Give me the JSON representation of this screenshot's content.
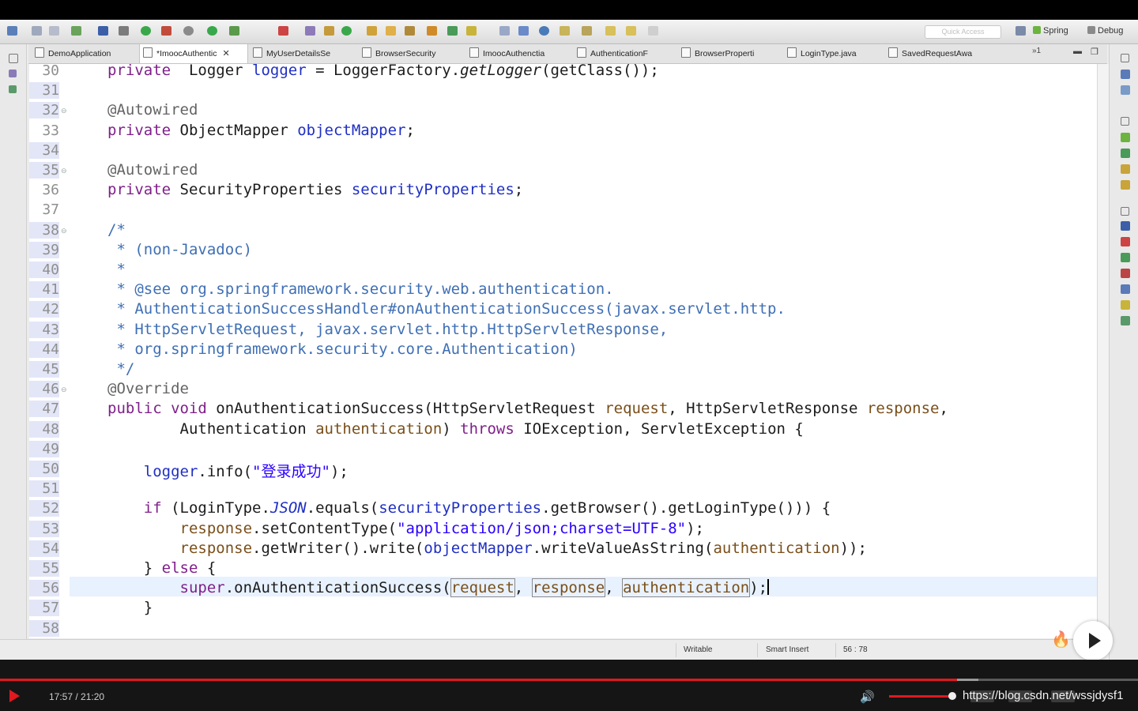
{
  "toolbar": {
    "quick_access_placeholder": "Quick Access",
    "perspectives": [
      {
        "label": "Spring",
        "icon": "spring-leaf-icon",
        "color": "#6db33f"
      },
      {
        "label": "Debug",
        "icon": "debug-bug-icon",
        "color": "#6a6a6a"
      }
    ]
  },
  "tabs": [
    {
      "label": "DemoApplication",
      "active": false,
      "dirty": false
    },
    {
      "label": "*ImoocAuthentic",
      "active": true,
      "dirty": true,
      "close_glyph": "✕"
    },
    {
      "label": "MyUserDetailsSe",
      "active": false
    },
    {
      "label": "BrowserSecurity",
      "active": false
    },
    {
      "label": "ImoocAuthenctia",
      "active": false
    },
    {
      "label": "AuthenticationF",
      "active": false
    },
    {
      "label": "BrowserProperti",
      "active": false
    },
    {
      "label": "LoginType.java",
      "active": false
    },
    {
      "label": "SavedRequestAwa",
      "active": false
    }
  ],
  "tabs_overflow": "»1",
  "editor": {
    "current_line": 56,
    "line_numbers": [
      "30",
      "31",
      "32",
      "33",
      "34",
      "35",
      "36",
      "37",
      "38",
      "39",
      "40",
      "41",
      "42",
      "43",
      "44",
      "45",
      "46",
      "47",
      "48",
      "49",
      "50",
      "51",
      "52",
      "53",
      "54",
      "55",
      "56",
      "57",
      "58"
    ],
    "lines": [
      {
        "no": 30,
        "seg": [
          [
            "kw",
            "private"
          ],
          [
            "",
            "  Logger "
          ],
          [
            "fld",
            "logger"
          ],
          [
            "",
            " = LoggerFactory."
          ],
          [
            "it",
            "getLogger"
          ],
          [
            "",
            "(getClass());"
          ]
        ]
      },
      {
        "no": 31,
        "seg": []
      },
      {
        "no": 32,
        "seg": [
          [
            "ann",
            "@Autowired"
          ]
        ]
      },
      {
        "no": 33,
        "seg": [
          [
            "kw",
            "private"
          ],
          [
            "",
            " ObjectMapper "
          ],
          [
            "fld",
            "objectMapper"
          ],
          [
            "",
            ";"
          ]
        ]
      },
      {
        "no": 34,
        "seg": []
      },
      {
        "no": 35,
        "seg": [
          [
            "ann",
            "@Autowired"
          ]
        ]
      },
      {
        "no": 36,
        "seg": [
          [
            "kw",
            "private"
          ],
          [
            "",
            " SecurityProperties "
          ],
          [
            "fld",
            "securityProperties"
          ],
          [
            "",
            ";"
          ]
        ]
      },
      {
        "no": 37,
        "seg": []
      },
      {
        "no": 38,
        "seg": [
          [
            "cmt",
            "/*"
          ]
        ]
      },
      {
        "no": 39,
        "seg": [
          [
            "cmt",
            " * (non-Javadoc)"
          ]
        ]
      },
      {
        "no": 40,
        "seg": [
          [
            "cmt",
            " *"
          ]
        ]
      },
      {
        "no": 41,
        "seg": [
          [
            "cmt",
            " * @see org.springframework.security.web.authentication."
          ]
        ]
      },
      {
        "no": 42,
        "seg": [
          [
            "cmt",
            " * AuthenticationSuccessHandler#onAuthenticationSuccess(javax.servlet.http."
          ]
        ]
      },
      {
        "no": 43,
        "seg": [
          [
            "cmt",
            " * HttpServletRequest, javax.servlet.http.HttpServletResponse,"
          ]
        ]
      },
      {
        "no": 44,
        "seg": [
          [
            "cmt",
            " * org.springframework.security.core.Authentication)"
          ]
        ]
      },
      {
        "no": 45,
        "seg": [
          [
            "cmt",
            " */"
          ]
        ]
      },
      {
        "no": 46,
        "seg": [
          [
            "ann",
            "@Override"
          ]
        ]
      },
      {
        "no": 47,
        "seg": [
          [
            "kw",
            "public"
          ],
          [
            "",
            " "
          ],
          [
            "kw",
            "void"
          ],
          [
            "",
            " onAuthenticationSuccess(HttpServletRequest "
          ],
          [
            "par",
            "request"
          ],
          [
            "",
            ", HttpServletResponse "
          ],
          [
            "par",
            "response"
          ],
          [
            "",
            ","
          ]
        ]
      },
      {
        "no": 48,
        "seg": [
          [
            "",
            "        Authentication "
          ],
          [
            "par",
            "authentication"
          ],
          [
            "",
            ") "
          ],
          [
            "kw",
            "throws"
          ],
          [
            "",
            " IOException, ServletException {"
          ]
        ]
      },
      {
        "no": 49,
        "seg": []
      },
      {
        "no": 50,
        "seg": [
          [
            "",
            "    "
          ],
          [
            "fld",
            "logger"
          ],
          [
            "",
            ".info("
          ],
          [
            "str",
            "\"登录成功\""
          ],
          [
            "",
            ");"
          ]
        ]
      },
      {
        "no": 51,
        "seg": []
      },
      {
        "no": 52,
        "seg": [
          [
            "",
            "    "
          ],
          [
            "kw",
            "if"
          ],
          [
            "",
            " (LoginType."
          ],
          [
            "fldit",
            "JSON"
          ],
          [
            "",
            ".equals("
          ],
          [
            "fld",
            "securityProperties"
          ],
          [
            "",
            ".getBrowser().getLoginType())) {"
          ]
        ]
      },
      {
        "no": 53,
        "seg": [
          [
            "",
            "        "
          ],
          [
            "par",
            "response"
          ],
          [
            "",
            ".setContentType("
          ],
          [
            "str",
            "\"application/json;charset=UTF-8\""
          ],
          [
            "",
            ");"
          ]
        ]
      },
      {
        "no": 54,
        "seg": [
          [
            "",
            "        "
          ],
          [
            "par",
            "response"
          ],
          [
            "",
            ".getWriter().write("
          ],
          [
            "fld",
            "objectMapper"
          ],
          [
            "",
            ".writeValueAsString("
          ],
          [
            "par",
            "authentication"
          ],
          [
            "",
            "));"
          ]
        ]
      },
      {
        "no": 55,
        "seg": [
          [
            "",
            "    } "
          ],
          [
            "kw",
            "else"
          ],
          [
            "",
            " {"
          ]
        ]
      },
      {
        "no": 56,
        "seg": [
          [
            "",
            "        "
          ],
          [
            "kw",
            "super"
          ],
          [
            "",
            ".onAuthenticationSuccess("
          ],
          [
            "parbox",
            "request"
          ],
          [
            "",
            ", "
          ],
          [
            "parbox",
            "response"
          ],
          [
            "",
            ", "
          ],
          [
            "parbox",
            "authentication"
          ],
          [
            "",
            ");"
          ],
          [
            "caret",
            ""
          ]
        ]
      },
      {
        "no": 57,
        "seg": [
          [
            "",
            "    }"
          ]
        ]
      },
      {
        "no": 58,
        "seg": []
      }
    ]
  },
  "status": {
    "writable": "Writable",
    "insert_mode": "Smart Insert",
    "position": "56 : 78"
  },
  "player": {
    "time": "17:57 / 21:20",
    "progress": 0.841,
    "buffered": 0.86,
    "volume": 1.0,
    "overlay_text": "https://blog.csdn.net/wssjdysf1"
  },
  "colors": {
    "keyword": "#7f1f8a",
    "field": "#1f2fc4",
    "comment": "#3f6fb5",
    "string": "#2a00ff",
    "annotation": "#646464",
    "current_line": "#e8f2fe",
    "progress_red": "#e0191f"
  }
}
